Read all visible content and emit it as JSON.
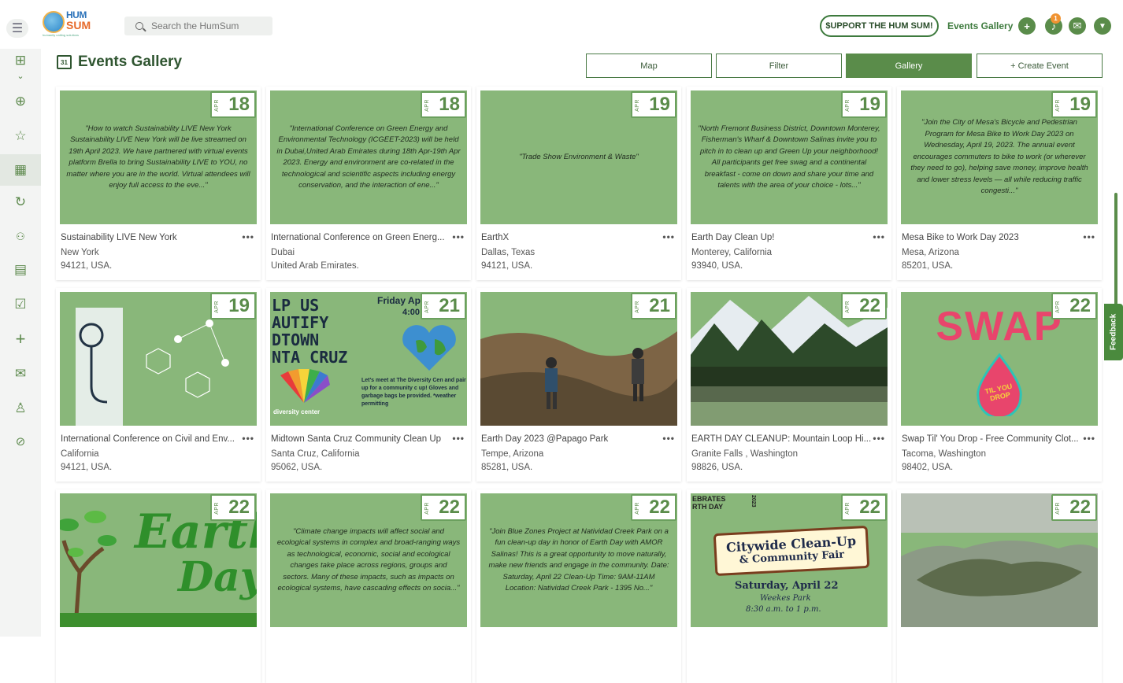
{
  "header": {
    "logo": {
      "line1": "HUM",
      "line2": "SUM",
      "tagline": "humanity uniting solutions"
    },
    "search_placeholder": "Search the HumSum",
    "support_label": "$UPPORT THE HUM SUM!",
    "events_gallery_link": "Events Gallery",
    "notification_count": "1"
  },
  "page": {
    "title": "Events Gallery",
    "calendar_day": "31",
    "view_tabs": [
      {
        "label": "Map"
      },
      {
        "label": "Filter"
      },
      {
        "label": "Gallery"
      },
      {
        "label": "+ Create Event"
      }
    ]
  },
  "sidebar": {
    "items": [
      "dashboard-icon",
      "chevron-down-icon",
      "gift-icon",
      "star-icon",
      "calendar-icon",
      "refresh-icon",
      "people-icon",
      "contacts-icon",
      "checklist-icon",
      "plus-icon",
      "mail-icon",
      "user-icon",
      "help-icon"
    ]
  },
  "feedback_label": "Feedback",
  "events": [
    {
      "month": "APR",
      "day": "18",
      "desc": "\"How to watch Sustainability LIVE New York Sustainability LIVE New York will be live streamed on 19th April 2023. We have partnered with virtual events platform Brella to bring Sustainability LIVE to YOU, no matter where you are in the world. Virtual attendees will enjoy full access to the eve...\"",
      "title": "Sustainability LIVE New York",
      "loc1": "New York",
      "loc2": "94121, USA."
    },
    {
      "month": "APR",
      "day": "18",
      "desc": "\"International Conference on Green Energy and Environmental Technology (ICGEET-2023) will be held in Dubai,United Arab Emirates during 18th Apr-19th Apr 2023. Energy and environment are co-related in the technological and scientific aspects including energy conservation, and the interaction of ene...\"",
      "title": "International Conference on Green Energ...",
      "loc1": "Dubai",
      "loc2": "United Arab Emirates."
    },
    {
      "month": "APR",
      "day": "19",
      "desc": "\"Trade Show Environment & Waste\"",
      "title": "EarthX",
      "loc1": "Dallas, Texas",
      "loc2": "94121, USA."
    },
    {
      "month": "APR",
      "day": "19",
      "desc": "\"North Fremont Business District, Downtown Monterey, Fisherman's Wharf & Downtown Salinas invite you to pitch in to clean up and Green Up your neighborhood! All participants get free swag and a continental breakfast - come on down and share your time and talents with the area of your choice - lots...\"",
      "title": "Earth Day Clean Up!",
      "loc1": "Monterey, California",
      "loc2": "93940, USA."
    },
    {
      "month": "APR",
      "day": "19",
      "desc": "\"Join the City of Mesa's Bicycle and Pedestrian Program for Mesa Bike to Work Day 2023 on Wednesday, April 19, 2023. The annual event encourages commuters to bike to work (or wherever they need to go), helping save money, improve health and lower stress levels — all while reducing traffic congesti...\"",
      "title": "Mesa Bike to Work Day 2023",
      "loc1": "Mesa, Arizona",
      "loc2": "85201, USA."
    },
    {
      "month": "APR",
      "day": "19",
      "image": "medical",
      "title": "International Conference on Civil and Env...",
      "loc1": "California",
      "loc2": "94121, USA."
    },
    {
      "month": "APR",
      "day": "21",
      "image": "flyer",
      "flyer_lines": [
        "LP US",
        "AUTIFY",
        "DTOWN",
        "NTA CRUZ"
      ],
      "flyer_date": "Friday Ap",
      "flyer_time": "4:00",
      "flyer_text": "Let's meet at The Diversity Cen and pair up for a community c up! Gloves and garbage bags be provided. *weather permitting",
      "flyer_org": "diversity center",
      "title": "Midtown Santa Cruz Community Clean Up",
      "loc1": "Santa Cruz, California",
      "loc2": "95062, USA."
    },
    {
      "month": "APR",
      "day": "21",
      "image": "hike",
      "title": "Earth Day 2023 @Papago Park",
      "loc1": "Tempe, Arizona",
      "loc2": "85281, USA."
    },
    {
      "month": "APR",
      "day": "22",
      "image": "mountain",
      "title": "EARTH DAY CLEANUP: Mountain Loop Hi...",
      "loc1": "Granite Falls , Washington",
      "loc2": "98826, USA."
    },
    {
      "month": "APR",
      "day": "22",
      "image": "swap",
      "swap_word": "SWAP",
      "swap_sub": "TIL YOU DROP",
      "title": "Swap Til' You Drop - Free Community Clot...",
      "loc1": "Tacoma, Washington",
      "loc2": "98402, USA."
    },
    {
      "month": "APR",
      "day": "22",
      "image": "earth",
      "earth_word1": "Earth",
      "earth_word2": "Day"
    },
    {
      "month": "APR",
      "day": "22",
      "desc": "\"Climate change impacts will affect social and ecological systems in complex and broad-ranging ways as technological, economic, social and ecological changes take place across regions, groups and sectors. Many of these impacts, such as impacts on ecological systems, have cascading effects on socia...\""
    },
    {
      "month": "APR",
      "day": "22",
      "desc": "\"Join Blue Zones Project at Natividad Creek Park on a fun clean-up day in honor of Earth Day with AMOR Salinas! This is a great opportunity to move naturally, make new friends and engage in the community. Date: Saturday, April 22 Clean-Up Time: 9AM-11AM Location: Natividad Creek Park - 1395 No...\""
    },
    {
      "month": "APR",
      "day": "22",
      "image": "fair",
      "fair_top": "EBRATES",
      "fair_top2": "RTH DAY",
      "fair_year": "2023",
      "fair_title1": "Citywide Clean-Up",
      "fair_title2": "& Community Fair",
      "fair_date": "Saturday, April 22",
      "fair_place": "Weekes Park",
      "fair_time": "8:30 a.m. to 1 p.m."
    },
    {
      "month": "APR",
      "day": "22",
      "image": "aerial"
    }
  ]
}
